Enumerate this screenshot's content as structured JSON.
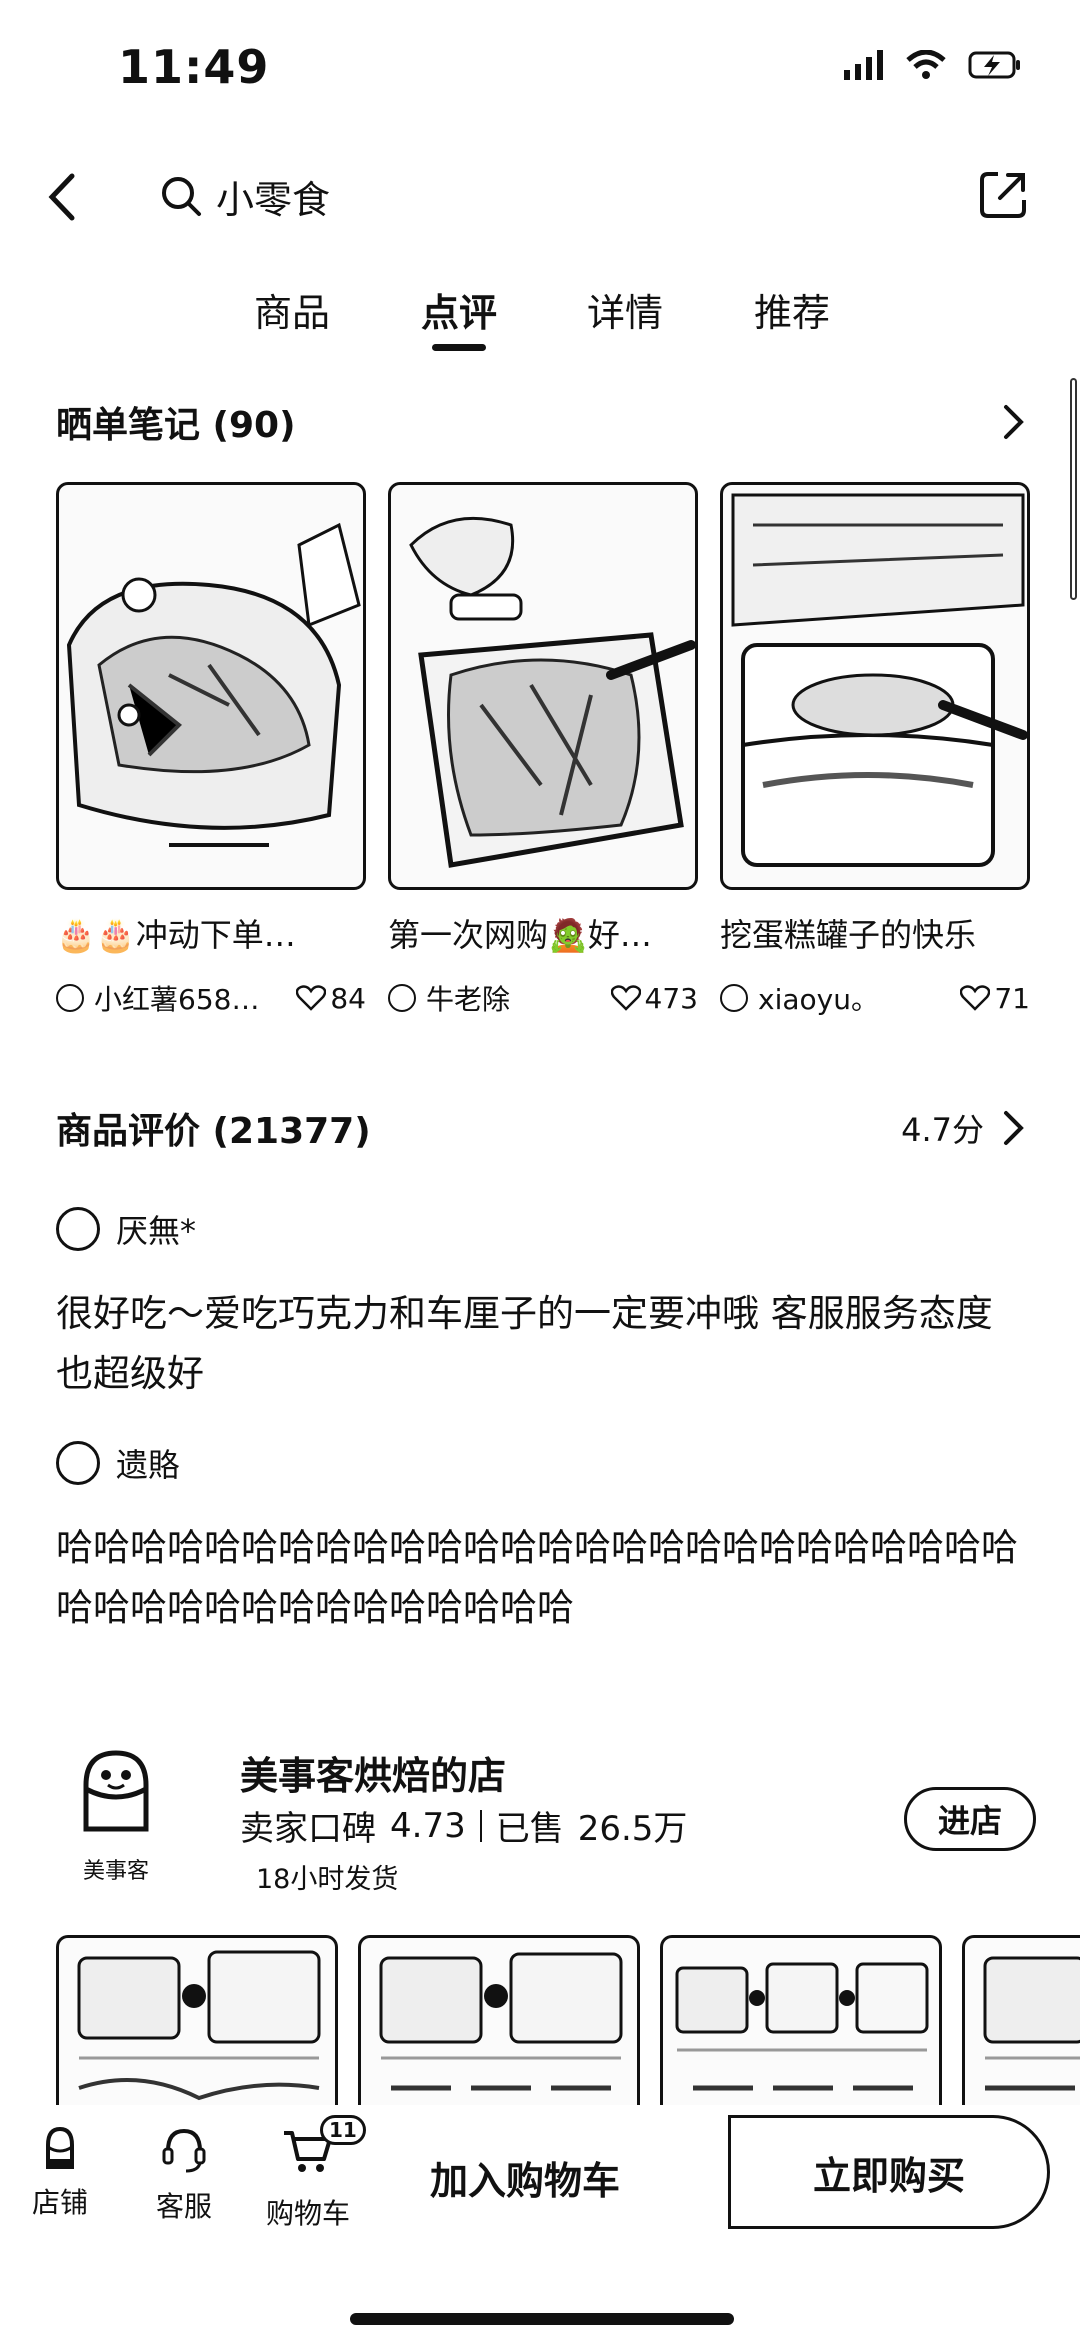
{
  "status": {
    "time": "11:49"
  },
  "header": {
    "search_text": "小零食"
  },
  "tabs": [
    "商品",
    "点评",
    "详情",
    "推荐"
  ],
  "notes_section": {
    "title": "晒单笔记 (90)",
    "items": [
      {
        "title": "🎂🎂冲动下单…",
        "user": "小红薯658…",
        "likes": "84"
      },
      {
        "title": "第一次网购🧟好…",
        "user": "牛老除",
        "likes": "473"
      },
      {
        "title": "挖蛋糕罐子的快乐",
        "user": "xiaoyu。",
        "likes": "71"
      }
    ]
  },
  "reviews_section": {
    "title": "商品评价 (21377)",
    "score": "4.7分",
    "items": [
      {
        "user": "厌無*",
        "text": "很好吃～爱吃巧克力和车厘子的一定要冲哦 客服服务态度也超级好"
      },
      {
        "user": "遗賂",
        "text": "哈哈哈哈哈哈哈哈哈哈哈哈哈哈哈哈哈哈哈哈哈哈哈哈哈哈哈哈哈哈哈哈哈哈哈哈哈哈哈哈"
      }
    ]
  },
  "shop": {
    "logo_text": "美事客",
    "name": "美事客烘焙的店",
    "rating_label": "卖家口碑",
    "rating": "4.73",
    "sold_label": "已售",
    "sold": "26.5万",
    "ship": "18小时发货",
    "enter_label": "进店"
  },
  "bottom_bar": {
    "store_label": "店铺",
    "service_label": "客服",
    "cart_label": "购物车",
    "cart_count": "11",
    "add_cart_label": "加入购物车",
    "buy_label": "立即购买"
  }
}
